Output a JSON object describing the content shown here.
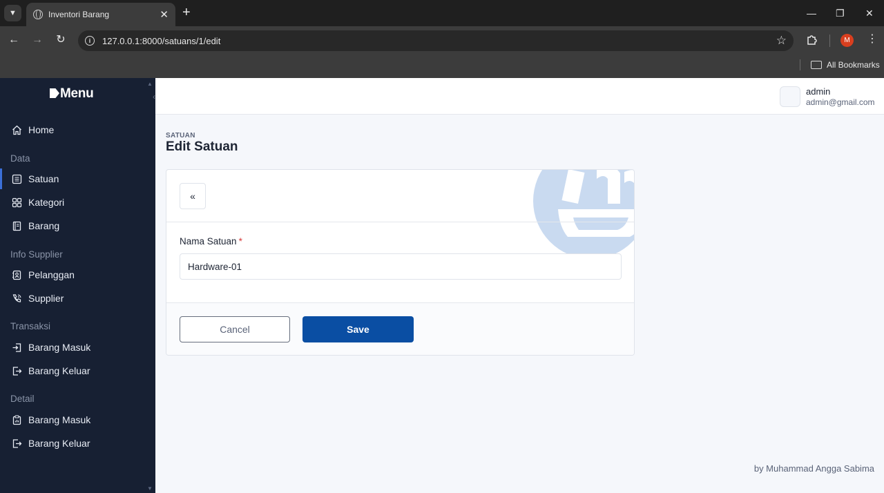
{
  "browser": {
    "tab_title": "Inventori Barang",
    "url": "127.0.0.1:8000/satuans/1/edit",
    "profile_initial": "M",
    "bookmarks_label": "All Bookmarks"
  },
  "sidebar": {
    "brand": "Menu",
    "home": "Home",
    "sections": [
      {
        "title": "Data",
        "items": [
          "Satuan",
          "Kategori",
          "Barang"
        ]
      },
      {
        "title": "Info Supplier",
        "items": [
          "Pelanggan",
          "Supplier"
        ]
      },
      {
        "title": "Transaksi",
        "items": [
          "Barang Masuk",
          "Barang Keluar"
        ]
      },
      {
        "title": "Detail",
        "items": [
          "Barang Masuk",
          "Barang Keluar"
        ]
      }
    ],
    "active_item": "Satuan"
  },
  "user": {
    "name": "admin",
    "email": "admin@gmail.com"
  },
  "page": {
    "pretitle": "SATUAN",
    "title": "Edit Satuan"
  },
  "form": {
    "back_label": "«",
    "field_label": "Nama Satuan",
    "required_mark": "*",
    "field_value": "Hardware-01",
    "cancel_label": "Cancel",
    "save_label": "Save"
  },
  "footer": {
    "credit": "by Muhammad Angga Sabima"
  },
  "colors": {
    "sidebar_bg": "#172033",
    "primary": "#0a4ea3",
    "required": "#d63939",
    "watermark": "#c9daf0"
  }
}
